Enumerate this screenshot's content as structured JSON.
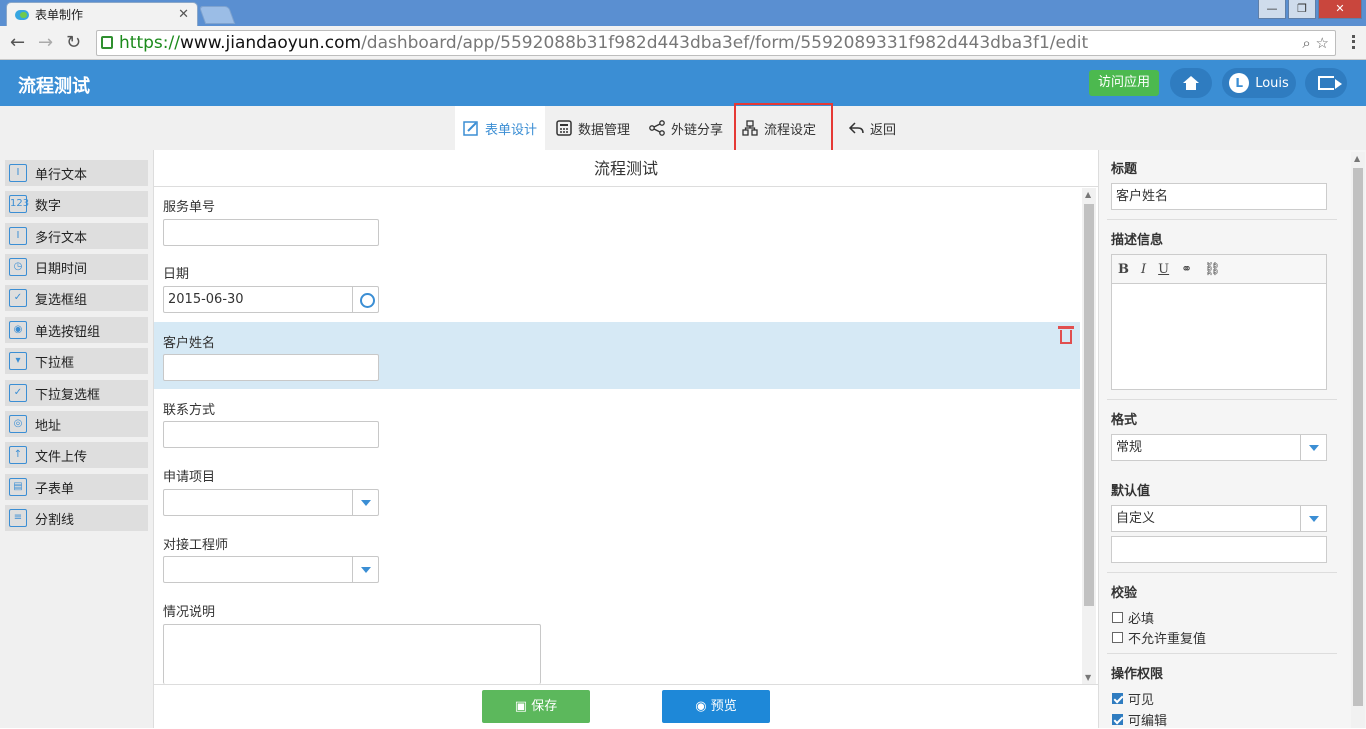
{
  "browser": {
    "tab_title": "表单制作",
    "tab_close": "✕",
    "win_min": "—",
    "win_max": "❐",
    "win_close": "✕",
    "back": "←",
    "forward": "→",
    "reload": "↻",
    "url_scheme": "https://",
    "url_host": "www.jiandaoyun.com",
    "url_path": "/dashboard/app/5592088b31f982d443dba3ef/form/5592089331f982d443dba3f1/edit",
    "zoom_icon": "⌕",
    "star_icon": "☆"
  },
  "app": {
    "title": "流程测试",
    "visit_label": "访问应用",
    "user_initial": "L",
    "user_name": "Louis",
    "brand_color": "#3b8ed4"
  },
  "toolbar": {
    "tabs": [
      {
        "label": "表单设计",
        "icon": "edit-icon",
        "active": true
      },
      {
        "label": "数据管理",
        "icon": "calculator-icon"
      },
      {
        "label": "外链分享",
        "icon": "share-icon"
      },
      {
        "label": "流程设定",
        "icon": "flow-icon"
      },
      {
        "label": "返回",
        "icon": "back-arrow-icon"
      }
    ]
  },
  "palette": {
    "items": [
      {
        "label": "单行文本",
        "glyph": "I"
      },
      {
        "label": "数字",
        "glyph": "123"
      },
      {
        "label": "多行文本",
        "glyph": "I"
      },
      {
        "label": "日期时间",
        "glyph": "◷"
      },
      {
        "label": "复选框组",
        "glyph": "✓"
      },
      {
        "label": "单选按钮组",
        "glyph": "◉"
      },
      {
        "label": "下拉框",
        "glyph": "▾"
      },
      {
        "label": "下拉复选框",
        "glyph": "✓"
      },
      {
        "label": "地址",
        "glyph": "◎"
      },
      {
        "label": "文件上传",
        "glyph": "↑"
      },
      {
        "label": "子表单",
        "glyph": "▤"
      },
      {
        "label": "分割线",
        "glyph": "≡"
      }
    ]
  },
  "form": {
    "title": "流程测试",
    "fields": [
      {
        "label": "服务单号",
        "value": ""
      },
      {
        "label": "日期",
        "value": "2015-06-30"
      },
      {
        "label": "客户姓名",
        "value": ""
      },
      {
        "label": "联系方式",
        "value": ""
      },
      {
        "label": "申请项目",
        "value": ""
      },
      {
        "label": "对接工程师",
        "value": ""
      },
      {
        "label": "情况说明",
        "value": ""
      }
    ],
    "save_label": "保存",
    "preview_label": "预览",
    "save_icon": "▣",
    "preview_icon": "◉",
    "save_color": "#5cb85c",
    "preview_color": "#1e88d8"
  },
  "props": {
    "title_label": "标题",
    "title_value": "客户姓名",
    "desc_label": "描述信息",
    "editor_buttons": [
      "B",
      "I",
      "U",
      "⚭",
      "⛓"
    ],
    "format_label": "格式",
    "format_value": "常规",
    "default_label": "默认值",
    "default_value": "自定义",
    "validation_label": "校验",
    "required_label": "必填",
    "no_dup_label": "不允许重复值",
    "perm_label": "操作权限",
    "visible_label": "可见",
    "editable_label": "可编辑"
  }
}
